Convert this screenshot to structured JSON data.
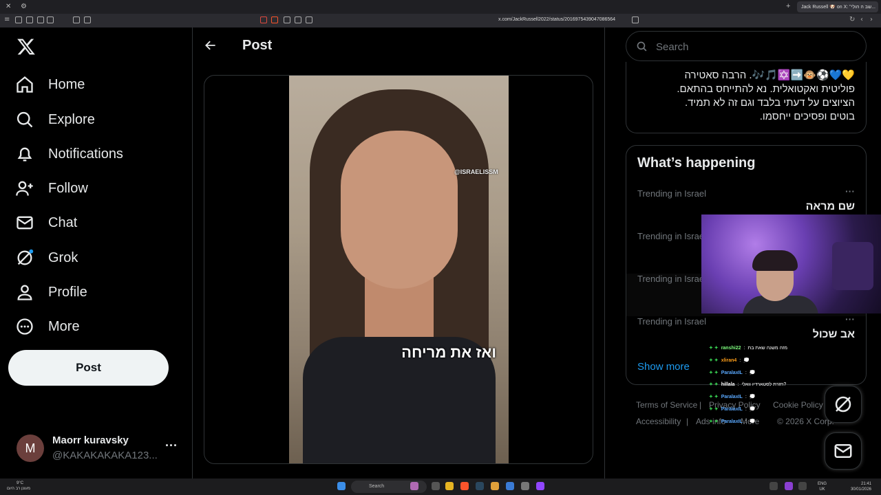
{
  "browser": {
    "tab_title": "Jack Russell 🐶 on X: \"שב ה הולי...",
    "url": "x.com/JackRussell2022/status/2016975439047086564"
  },
  "sidebar": {
    "items": [
      {
        "label": "Home",
        "icon": "home-icon"
      },
      {
        "label": "Explore",
        "icon": "search-icon"
      },
      {
        "label": "Notifications",
        "icon": "bell-icon"
      },
      {
        "label": "Follow",
        "icon": "follow-icon"
      },
      {
        "label": "Chat",
        "icon": "mail-icon"
      },
      {
        "label": "Grok",
        "icon": "grok-icon"
      },
      {
        "label": "Profile",
        "icon": "person-icon"
      },
      {
        "label": "More",
        "icon": "more-circle-icon"
      }
    ],
    "post_button": "Post"
  },
  "account": {
    "avatar_initial": "M",
    "name": "Maorr kuravsky",
    "handle": "@KAKAKAKAKA123..."
  },
  "post": {
    "title": "Post",
    "video_caption": "ואז את מריחה",
    "video_watermark": "@ISRAELISSM"
  },
  "search": {
    "placeholder": "Search"
  },
  "bio": {
    "line1": "💛💙⚽🐵➡️✡️🎵🎶. הרבה סאטירה",
    "line2": "פוליטית ואקטואלית. נא להתייחס בהתאם.",
    "line3": "הציוצים על דעתי בלבד וגם זה לא תמיד.",
    "line4": "בוטים ופסיכים ייחסמו."
  },
  "trends": {
    "title": "What’s happening",
    "items": [
      {
        "context": "Trending in Israel",
        "name": "שם מראה"
      },
      {
        "context": "Trending in Israel",
        "name": ""
      },
      {
        "context": "Trending in Israel",
        "name": ""
      },
      {
        "context": "Trending in Israel",
        "name": "אב שכול"
      }
    ],
    "show_more": "Show more"
  },
  "footer": {
    "terms": "Terms of Service",
    "privacy": "Privacy Policy",
    "cookie": "Cookie Policy",
    "accessibility": "Accessibility",
    "ads": "Ads info",
    "more": "More",
    "copyright": "© 2026 X Corp."
  },
  "chat": [
    {
      "user": "ranshi22",
      "color": "#7fff7f",
      "msg": "מזה משנה שאת בת"
    },
    {
      "user": "xliran4",
      "color": "#ff9f1a",
      "msg": "💭"
    },
    {
      "user": "ParalaxIL",
      "color": "#5aa9ff",
      "msg": "💭"
    },
    {
      "user": "hillala",
      "color": "#ffffff",
      "msg": "חזרת לסטארדיו וואלי?"
    },
    {
      "user": "ParalaxIL",
      "color": "#5aa9ff",
      "msg": "💭"
    },
    {
      "user": "ParalaxIL",
      "color": "#5aa9ff",
      "msg": "💭"
    },
    {
      "user": "ParalaxIL",
      "color": "#5aa9ff",
      "msg": "💭"
    }
  ],
  "taskbar": {
    "weather_temp": "9°C",
    "weather_desc": "מעונן רב היום",
    "search_label": "Search",
    "lang_top": "ENG",
    "lang_bottom": "UK",
    "time": "21:41",
    "date": "30/01/2026"
  }
}
